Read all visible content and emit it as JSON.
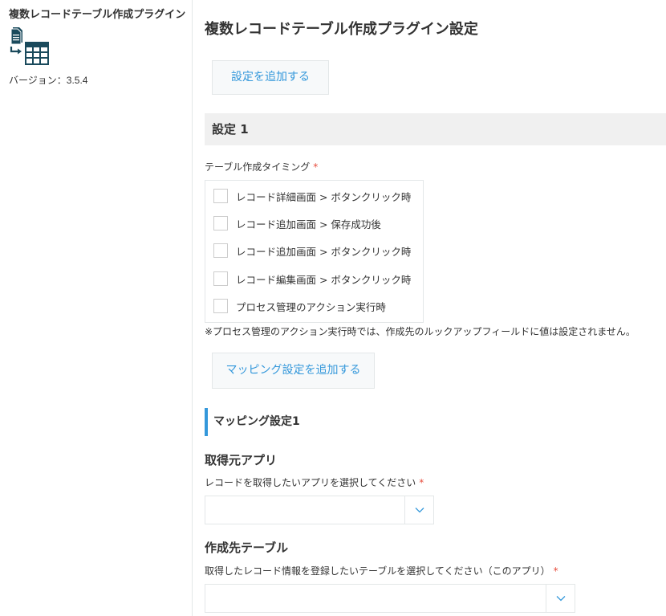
{
  "sidebar": {
    "plugin_name": "複数レコードテーブル作成プラグイン",
    "version_label": "バージョン：",
    "version_number": "3.5.4"
  },
  "main": {
    "title": "複数レコードテーブル作成プラグイン設定",
    "add_setting_button": "設定を追加する",
    "setting_header": "設定 1",
    "timing": {
      "label": "テーブル作成タイミング",
      "required_mark": "*",
      "options": [
        {
          "label": "レコード詳細画面 > ボタンクリック時",
          "checked": false
        },
        {
          "label": "レコード追加画面 > 保存成功後",
          "checked": false
        },
        {
          "label": "レコード追加画面 > ボタンクリック時",
          "checked": false
        },
        {
          "label": "レコード編集画面 > ボタンクリック時",
          "checked": false
        },
        {
          "label": "プロセス管理のアクション実行時",
          "checked": false
        }
      ]
    },
    "note": "※プロセス管理のアクション実行時では、作成先のルックアップフィールドに値は設定されません。",
    "add_mapping_button": "マッピング設定を追加する",
    "mapping_header": "マッピング設定1",
    "source_app": {
      "title": "取得元アプリ",
      "label": "レコードを取得したいアプリを選択してください",
      "required_mark": "*",
      "value": ""
    },
    "target_table": {
      "title": "作成先テーブル",
      "label": "取得したレコード情報を登録したいテーブルを選択してください（このアプリ）",
      "required_mark": "*",
      "value": ""
    }
  },
  "colors": {
    "accent": "#3498db",
    "required": "#e74c3c",
    "icon": "#1a4a5c",
    "section_bg": "#f0f0f0",
    "border": "#e3e7e8"
  },
  "icons": {
    "plugin": "document-to-table-icon",
    "dropdown": "chevron-down-icon"
  }
}
